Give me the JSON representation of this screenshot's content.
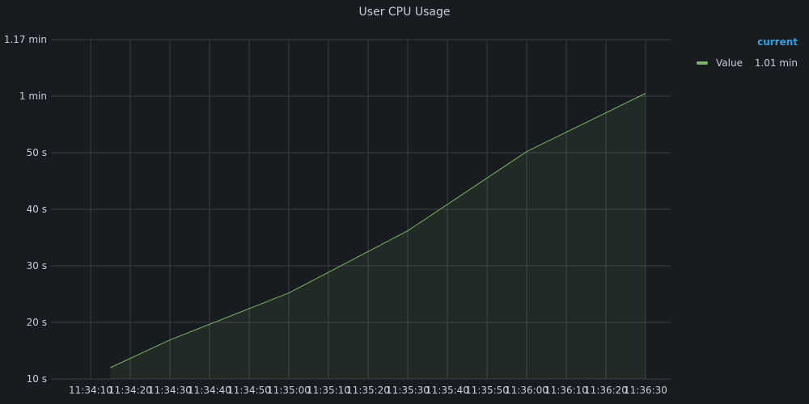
{
  "panel": {
    "title": "User CPU Usage"
  },
  "colors": {
    "background": "#181b1f",
    "grid": "#3a3d42",
    "text": "#ccccdc",
    "series": "#7eb26d",
    "legend_header": "#33a2e5"
  },
  "legend": {
    "header": "current",
    "items": [
      {
        "name": "Value",
        "value": "1.01 min",
        "color": "#7eb26d"
      }
    ]
  },
  "chart_data": {
    "type": "area",
    "title": "User CPU Usage",
    "xlabel": "",
    "ylabel": "",
    "x_tick_labels": [
      "11:34:10",
      "11:34:20",
      "11:34:30",
      "11:34:40",
      "11:34:50",
      "11:35:00",
      "11:35:10",
      "11:35:20",
      "11:35:30",
      "11:35:40",
      "11:35:50",
      "11:36:00",
      "11:36:10",
      "11:36:20",
      "11:36:30"
    ],
    "y_tick_values": [
      10,
      20,
      30,
      40,
      50,
      60,
      70
    ],
    "y_tick_labels": [
      "10 s",
      "20 s",
      "30 s",
      "40 s",
      "50 s",
      "1 min",
      "1.17 min"
    ],
    "ylim": [
      10,
      70
    ],
    "grid": true,
    "legend_position": "right",
    "series": [
      {
        "name": "Value",
        "x": [
          "11:34:15",
          "11:34:30",
          "11:35:00",
          "11:35:30",
          "11:36:00",
          "11:36:30"
        ],
        "values": [
          12.0,
          16.9,
          25.2,
          36.2,
          50.2,
          60.5
        ]
      }
    ]
  }
}
